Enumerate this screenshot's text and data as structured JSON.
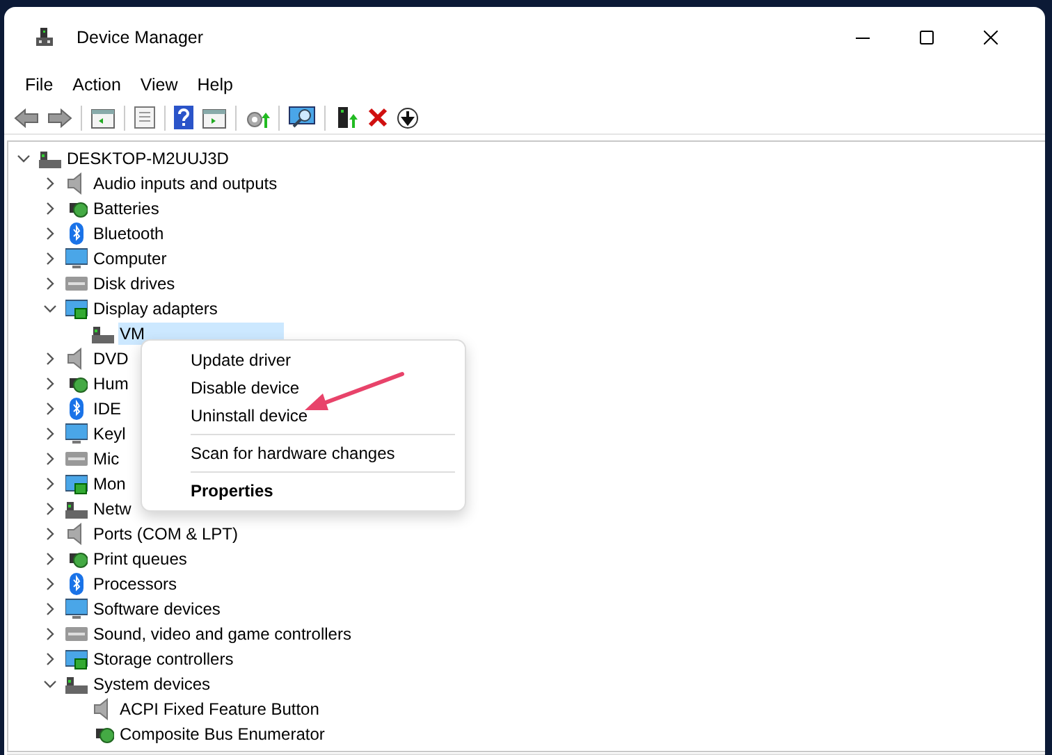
{
  "window": {
    "title": "Device Manager"
  },
  "menu_bar": [
    "File",
    "Action",
    "View",
    "Help"
  ],
  "tree": [
    {
      "label": "DESKTOP-M2UUJ3D",
      "expanded": true,
      "selected": false,
      "children": [
        {
          "label": "Audio inputs and outputs",
          "expanded": false,
          "selected": false
        },
        {
          "label": "Batteries",
          "expanded": false,
          "selected": false
        },
        {
          "label": "Bluetooth",
          "expanded": false,
          "selected": false
        },
        {
          "label": "Computer",
          "expanded": false,
          "selected": false
        },
        {
          "label": "Disk drives",
          "expanded": false,
          "selected": false
        },
        {
          "label": "Display adapters",
          "expanded": true,
          "selected": false,
          "children": [
            {
              "label": "VM",
              "selected": true
            }
          ]
        },
        {
          "label": "DVD",
          "expanded": false,
          "selected": false
        },
        {
          "label": "Hum",
          "expanded": false,
          "selected": false
        },
        {
          "label": "IDE",
          "expanded": false,
          "selected": false
        },
        {
          "label": "Keyl",
          "expanded": false,
          "selected": false
        },
        {
          "label": "Mic",
          "expanded": false,
          "selected": false
        },
        {
          "label": "Mon",
          "expanded": false,
          "selected": false
        },
        {
          "label": "Netw",
          "expanded": false,
          "selected": false
        },
        {
          "label": "Ports (COM & LPT)",
          "expanded": false,
          "selected": false
        },
        {
          "label": "Print queues",
          "expanded": false,
          "selected": false
        },
        {
          "label": "Processors",
          "expanded": false,
          "selected": false
        },
        {
          "label": "Software devices",
          "expanded": false,
          "selected": false
        },
        {
          "label": "Sound, video and game controllers",
          "expanded": false,
          "selected": false
        },
        {
          "label": "Storage controllers",
          "expanded": false,
          "selected": false
        },
        {
          "label": "System devices",
          "expanded": true,
          "selected": false,
          "children": [
            {
              "label": "ACPI Fixed Feature Button",
              "selected": false
            },
            {
              "label": "Composite Bus Enumerator",
              "selected": false
            }
          ]
        }
      ]
    }
  ],
  "context_menu": [
    {
      "kind": "item",
      "label": "Update driver",
      "default": false
    },
    {
      "kind": "item",
      "label": "Disable device",
      "default": false
    },
    {
      "kind": "item",
      "label": "Uninstall device",
      "default": false
    },
    {
      "kind": "separator"
    },
    {
      "kind": "item",
      "label": "Scan for hardware changes",
      "default": false
    },
    {
      "kind": "separator"
    },
    {
      "kind": "item",
      "label": "Properties",
      "default": true
    }
  ]
}
